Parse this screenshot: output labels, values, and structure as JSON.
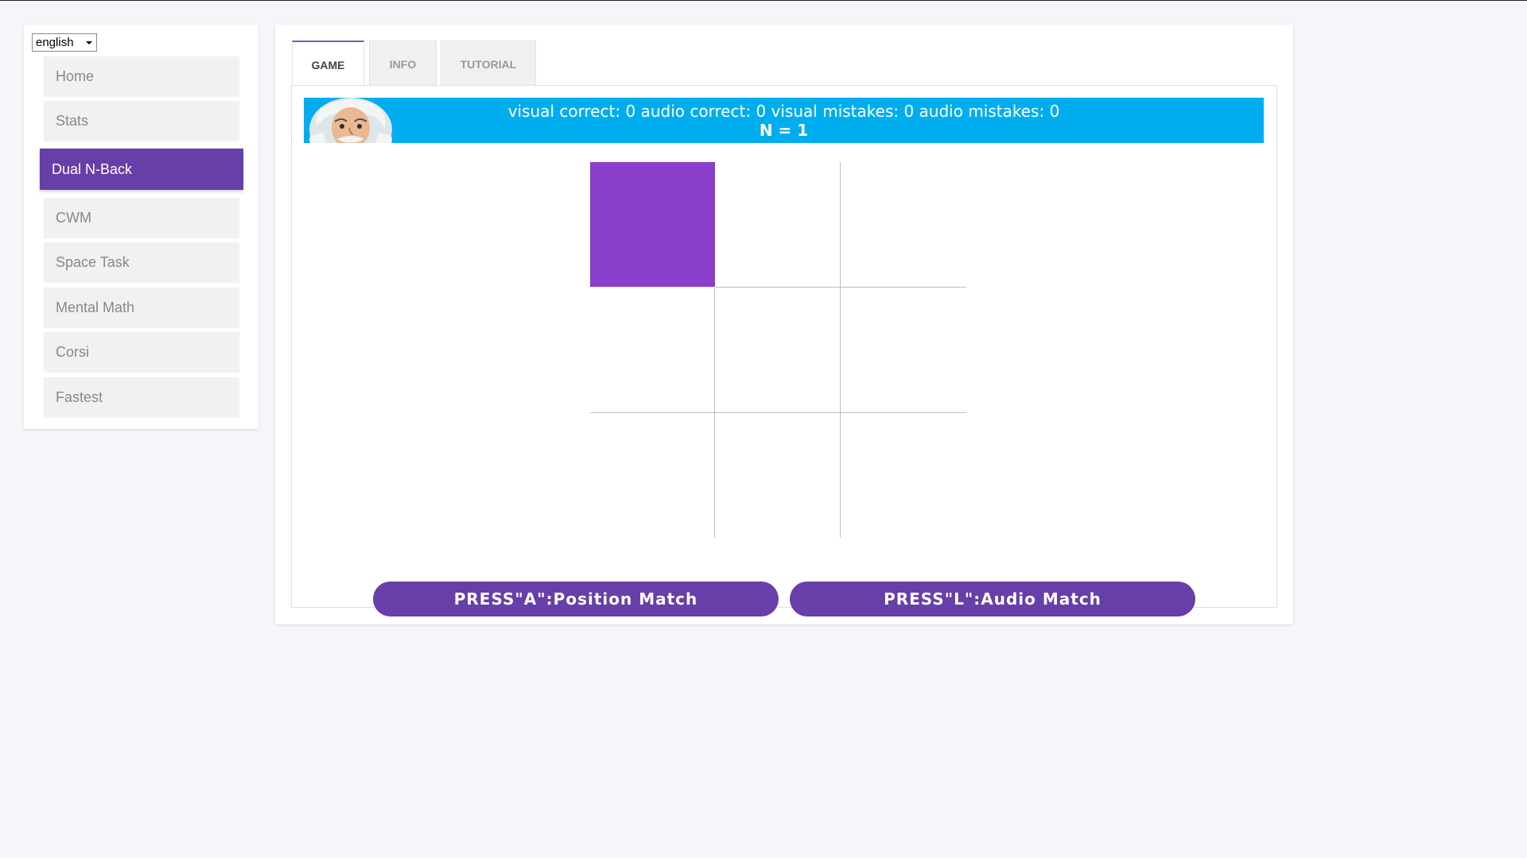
{
  "language": {
    "selected": "english"
  },
  "sidebar": {
    "items": [
      {
        "label": "Home"
      },
      {
        "label": "Stats"
      },
      {
        "label": "Dual N-Back"
      },
      {
        "label": "CWM"
      },
      {
        "label": "Space Task"
      },
      {
        "label": "Mental Math"
      },
      {
        "label": "Corsi"
      },
      {
        "label": "Fastest"
      }
    ],
    "active_item": "Dual N-Back"
  },
  "tabs": [
    {
      "label": "GAME"
    },
    {
      "label": "INFO"
    },
    {
      "label": "TUTORIAL"
    }
  ],
  "game": {
    "score_text": "visual correct: 0 audio correct: 0 visual mistakes: 0 audio mistakes: 0",
    "n_text": "N = 1",
    "active_cell": "top-left",
    "position_button": "PRESS\"A\":Position Match",
    "audio_button": "PRESS\"L\":Audio Match"
  },
  "colors": {
    "accent": "#663fa8",
    "score_bar": "#00aeef",
    "active_cell": "#8b3fcc"
  }
}
